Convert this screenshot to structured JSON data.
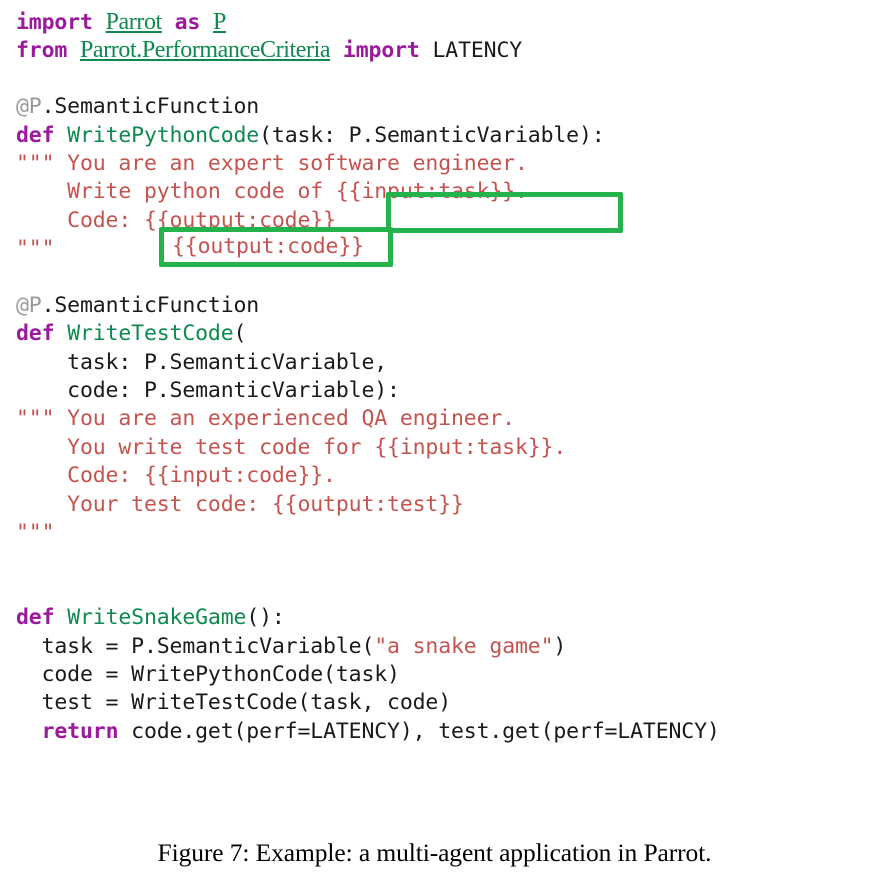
{
  "figure": {
    "caption": "Figure 7: Example: a multi-agent application in Parrot.",
    "colors": {
      "keyword_purple": "#9B1A9B",
      "module_green": "#0E8A4E",
      "function_green": "#0E8A4E",
      "docstring_red": "#C4544F",
      "decorator_gray": "#9A9A9A",
      "plain_black": "#1A1A1A",
      "annotation_green": "#24B24C",
      "background": "#FFFFFF"
    }
  },
  "code": {
    "language": "python",
    "lines": [
      {
        "id": "L01",
        "segments": [
          {
            "text": "import ",
            "style": "kw"
          },
          {
            "text": "Parrot",
            "style": "mod"
          },
          {
            "text": " as ",
            "style": "kw"
          },
          {
            "text": "P",
            "style": "mod"
          }
        ]
      },
      {
        "id": "L02",
        "segments": [
          {
            "text": "from ",
            "style": "kw"
          },
          {
            "text": "Parrot.PerformanceCriteria",
            "style": "mod"
          },
          {
            "text": " import ",
            "style": "kw"
          },
          {
            "text": "LATENCY",
            "style": "plain"
          }
        ]
      },
      {
        "id": "L03",
        "segments": []
      },
      {
        "id": "L04",
        "segments": [
          {
            "text": "@P",
            "style": "deco"
          },
          {
            "text": ".SemanticFunction",
            "style": "plain"
          }
        ]
      },
      {
        "id": "L05",
        "segments": [
          {
            "text": "def ",
            "style": "kw"
          },
          {
            "text": "WritePythonCode",
            "style": "fn"
          },
          {
            "text": "(task: P.SemanticVariable):",
            "style": "plain"
          }
        ]
      },
      {
        "id": "L06",
        "segments": [
          {
            "text": "\"\"\" You are an expert software engineer.",
            "style": "doc"
          }
        ]
      },
      {
        "id": "L07",
        "segments": [
          {
            "text": "    Write python code of {{input:task}}.",
            "style": "doc"
          }
        ]
      },
      {
        "id": "L08",
        "segments": [
          {
            "text": "    Code: {{output:code}}",
            "style": "doc"
          }
        ]
      },
      {
        "id": "L09",
        "segments": [
          {
            "text": "\"\"\"",
            "style": "doc"
          }
        ]
      },
      {
        "id": "L10",
        "segments": []
      },
      {
        "id": "L11",
        "segments": [
          {
            "text": "@P",
            "style": "deco"
          },
          {
            "text": ".SemanticFunction",
            "style": "plain"
          }
        ]
      },
      {
        "id": "L12",
        "segments": [
          {
            "text": "def ",
            "style": "kw"
          },
          {
            "text": "WriteTestCode",
            "style": "fn"
          },
          {
            "text": "(",
            "style": "plain"
          }
        ]
      },
      {
        "id": "L13",
        "segments": [
          {
            "text": "    task: P.SemanticVariable,",
            "style": "plain"
          }
        ]
      },
      {
        "id": "L14",
        "segments": [
          {
            "text": "    code: P.SemanticVariable):",
            "style": "plain"
          }
        ]
      },
      {
        "id": "L15",
        "segments": [
          {
            "text": "\"\"\" You are an experienced QA engineer.",
            "style": "doc"
          }
        ]
      },
      {
        "id": "L16",
        "segments": [
          {
            "text": "    You write test code for {{input:task}}.",
            "style": "doc"
          }
        ]
      },
      {
        "id": "L17",
        "segments": [
          {
            "text": "    Code: {{input:code}}.",
            "style": "doc"
          }
        ]
      },
      {
        "id": "L18",
        "segments": [
          {
            "text": "    Your test code: {{output:test}}",
            "style": "doc"
          }
        ]
      },
      {
        "id": "L19",
        "segments": [
          {
            "text": "\"\"\"",
            "style": "doc"
          }
        ]
      },
      {
        "id": "L20",
        "segments": []
      },
      {
        "id": "L21",
        "segments": []
      },
      {
        "id": "L22",
        "segments": [
          {
            "text": "def ",
            "style": "kw"
          },
          {
            "text": "WriteSnakeGame",
            "style": "fn"
          },
          {
            "text": "():",
            "style": "plain"
          }
        ]
      },
      {
        "id": "L23",
        "segments": [
          {
            "text": "  task = P.SemanticVariable(",
            "style": "plain"
          },
          {
            "text": "\"a snake game\"",
            "style": "doc"
          },
          {
            "text": ")",
            "style": "plain"
          }
        ]
      },
      {
        "id": "L24",
        "segments": [
          {
            "text": "  code = WritePythonCode(task)",
            "style": "plain"
          }
        ]
      },
      {
        "id": "L25",
        "segments": [
          {
            "text": "  test = WriteTestCode(task, code)",
            "style": "plain"
          }
        ]
      },
      {
        "id": "L26",
        "segments": [
          {
            "text": "  ",
            "style": "plain"
          },
          {
            "text": "return ",
            "style": "kw"
          },
          {
            "text": "code.get(perf=LATENCY), test.get(perf=LATENCY)",
            "style": "plain"
          }
        ]
      }
    ]
  },
  "annotations": [
    {
      "id": "annot-input-task",
      "label": "{{input:task}}.",
      "kind": "highlight-box",
      "target_line": "L07",
      "color": "#24B24C"
    },
    {
      "id": "annot-output-code",
      "label": "{{output:code}}",
      "kind": "highlight-box",
      "target_line": "L08",
      "color": "#24B24C"
    }
  ]
}
